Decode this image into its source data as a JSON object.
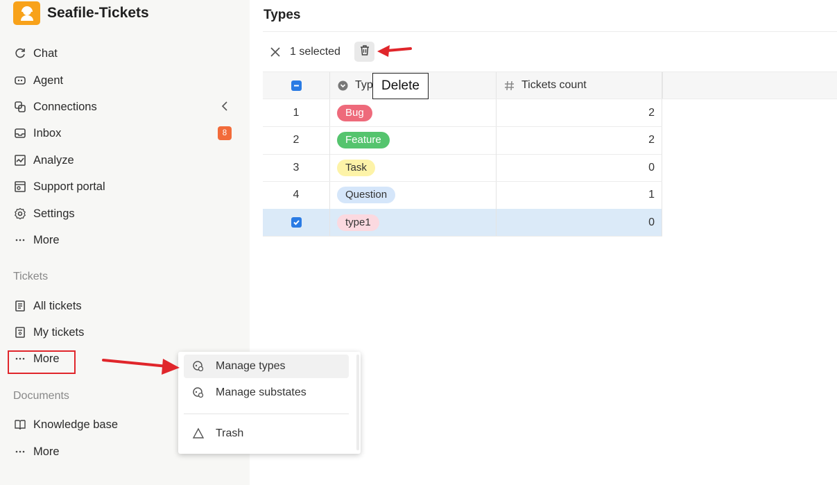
{
  "app": {
    "title": "Seafile-Tickets"
  },
  "sidebar": {
    "items": [
      {
        "label": "Chat",
        "icon": "chat-icon"
      },
      {
        "label": "Agent",
        "icon": "robot-icon"
      },
      {
        "label": "Connections",
        "icon": "link-icon"
      },
      {
        "label": "Inbox",
        "icon": "inbox-icon",
        "badge": "8"
      },
      {
        "label": "Analyze",
        "icon": "chart-icon"
      },
      {
        "label": "Support portal",
        "icon": "portal-icon"
      },
      {
        "label": "Settings",
        "icon": "gear-icon"
      },
      {
        "label": "More",
        "icon": "dots-icon"
      }
    ],
    "tickets_section": {
      "label": "Tickets",
      "items": [
        {
          "label": "All tickets",
          "icon": "list-icon"
        },
        {
          "label": "My tickets",
          "icon": "user-list-icon"
        },
        {
          "label": "More",
          "icon": "dots-icon"
        }
      ]
    },
    "documents_section": {
      "label": "Documents",
      "items": [
        {
          "label": "Knowledge base",
          "icon": "book-icon"
        },
        {
          "label": "More",
          "icon": "dots-icon"
        }
      ]
    }
  },
  "main": {
    "title": "Types",
    "toolbar": {
      "selected_text": "1 selected"
    },
    "tooltip": "Delete",
    "table": {
      "columns": [
        "Type",
        "Tickets count"
      ],
      "rows": [
        {
          "index": "1",
          "type": "Bug",
          "count": "2",
          "bg": "#ee6a7b",
          "fg": "#ffffff",
          "selected": false
        },
        {
          "index": "2",
          "type": "Feature",
          "count": "2",
          "bg": "#55c46e",
          "fg": "#ffffff",
          "selected": false
        },
        {
          "index": "3",
          "type": "Task",
          "count": "0",
          "bg": "#fdf3a8",
          "fg": "#333333",
          "selected": false
        },
        {
          "index": "4",
          "type": "Question",
          "count": "1",
          "bg": "#d5e6fa",
          "fg": "#333333",
          "selected": false
        },
        {
          "index": "",
          "type": "type1",
          "count": "0",
          "bg": "#fbd9e0",
          "fg": "#333333",
          "selected": true
        }
      ]
    }
  },
  "dropdown": {
    "items": [
      {
        "label": "Manage types",
        "icon": "type-settings-icon"
      },
      {
        "label": "Manage substates",
        "icon": "substate-settings-icon"
      },
      {
        "label": "Trash",
        "icon": "recycle-icon"
      }
    ]
  },
  "colors": {
    "accent": "#2a7be4",
    "brand": "#f8a21a",
    "badge": "#f26b3a",
    "annotation": "#e0262b"
  }
}
